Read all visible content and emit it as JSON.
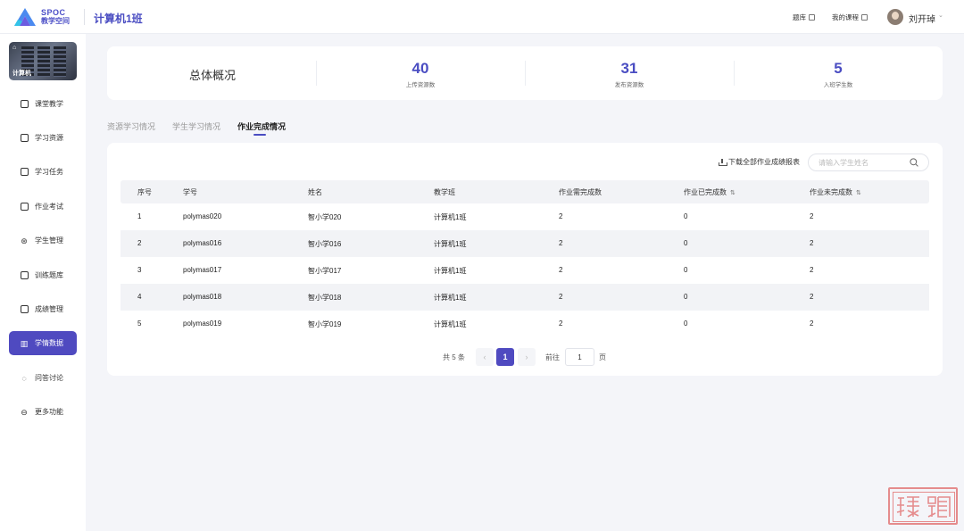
{
  "header": {
    "logo_en": "SPOC",
    "logo_cn": "教学空间",
    "class_title": "计算机1班",
    "links": [
      "题库",
      "我的课程"
    ],
    "user_name": "刘开琸"
  },
  "sidebar": {
    "course_label": "计算机",
    "items": [
      {
        "label": "课堂教学",
        "icon": "play-square-icon"
      },
      {
        "label": "学习资源",
        "icon": "monitor-icon"
      },
      {
        "label": "学习任务",
        "icon": "task-icon"
      },
      {
        "label": "作业考试",
        "icon": "document-icon"
      },
      {
        "label": "学生管理",
        "icon": "students-icon"
      },
      {
        "label": "训练题库",
        "icon": "question-bank-icon"
      },
      {
        "label": "成绩管理",
        "icon": "grade-icon"
      },
      {
        "label": "学情数据",
        "icon": "analytics-icon"
      },
      {
        "label": "问答讨论",
        "icon": "discussion-icon"
      },
      {
        "label": "更多功能",
        "icon": "more-icon"
      }
    ],
    "active_index": 7
  },
  "overview": {
    "title": "总体概况",
    "stats": [
      {
        "value": "40",
        "label": "上传资源数"
      },
      {
        "value": "31",
        "label": "发布资源数"
      },
      {
        "value": "5",
        "label": "入班学生数"
      }
    ]
  },
  "tabs": {
    "items": [
      "资源学习情况",
      "学生学习情况",
      "作业完成情况"
    ],
    "active_index": 2
  },
  "toolbar": {
    "download_label": "下载全部作业成绩报表",
    "search_placeholder": "请输入学生姓名"
  },
  "table": {
    "columns": [
      "序号",
      "学号",
      "姓名",
      "教学班",
      "作业需完成数",
      "作业已完成数",
      "作业未完成数"
    ],
    "rows": [
      [
        "1",
        "polymas020",
        "智小学020",
        "计算机1班",
        "2",
        "0",
        "2"
      ],
      [
        "2",
        "polymas016",
        "智小学016",
        "计算机1班",
        "2",
        "0",
        "2"
      ],
      [
        "3",
        "polymas017",
        "智小学017",
        "计算机1班",
        "2",
        "0",
        "2"
      ],
      [
        "4",
        "polymas018",
        "智小学018",
        "计算机1班",
        "2",
        "0",
        "2"
      ],
      [
        "5",
        "polymas019",
        "智小学019",
        "计算机1班",
        "2",
        "0",
        "2"
      ]
    ]
  },
  "pagination": {
    "total_text": "共 5 条",
    "current_page": "1",
    "goto_label": "前往",
    "goto_value": "1",
    "page_unit": "页"
  },
  "colors": {
    "accent": "#4f4ac0",
    "background": "#f4f5f9"
  }
}
